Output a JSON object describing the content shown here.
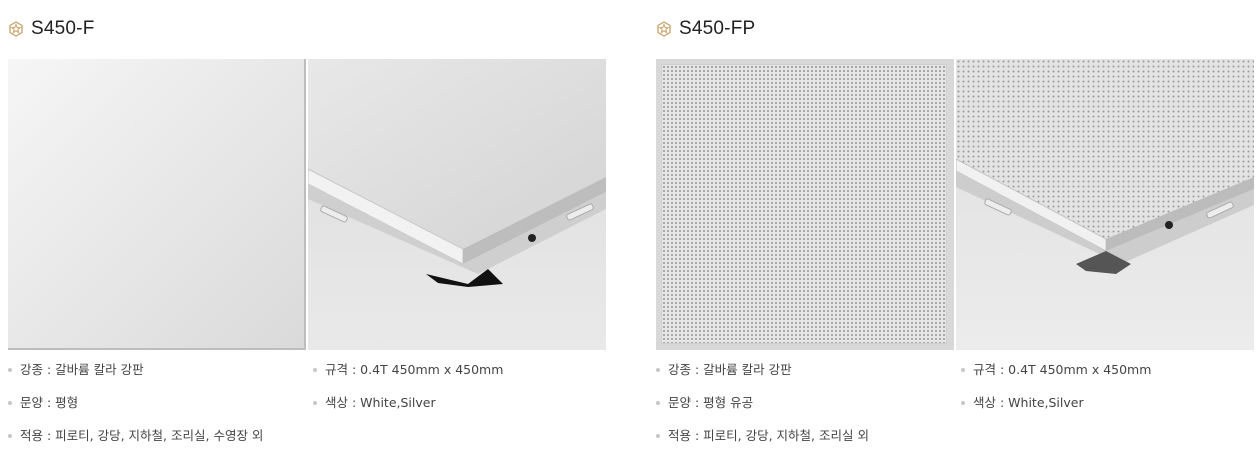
{
  "products": [
    {
      "title": "S450-F",
      "specs": {
        "material": "강종 : 갈바륨 칼라 강판",
        "size": "규격 : 0.4T 450mm x 450mm",
        "pattern": "문양 : 평형",
        "color": "색상 : White,Silver",
        "usage": "적용 : 피로티, 강당, 지하철, 조리실, 수영장 외"
      }
    },
    {
      "title": "S450-FP",
      "specs": {
        "material": "강종 : 갈바륨 칼라 강판",
        "size": "규격 : 0.4T 450mm x 450mm",
        "pattern": "문양 : 평형 유공",
        "color": "색상 : White,Silver",
        "usage": "적용 : 피로티, 강당, 지하철, 조리실 외"
      }
    }
  ],
  "colors": {
    "icon": "#c8a26b",
    "bullet": "#c7c7c7"
  },
  "icons": {
    "title": "hexagon-star-icon"
  }
}
